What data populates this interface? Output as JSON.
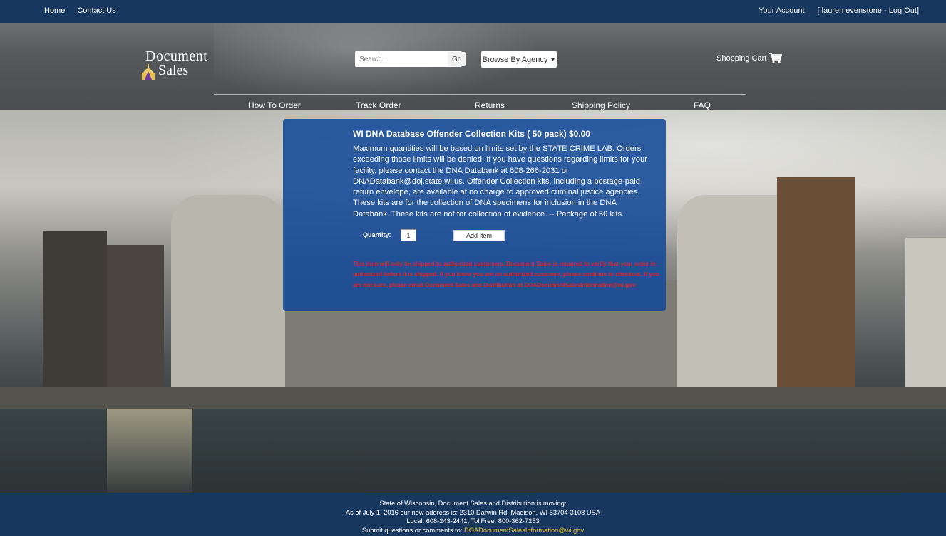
{
  "topbar": {
    "left_links": [
      "Home",
      "Contact Us"
    ],
    "account_label": "Your Account",
    "user_label": "[ lauren evenstone - Log Out]"
  },
  "header": {
    "logo": {
      "line1": "Document",
      "line2": "Sales"
    },
    "search": {
      "placeholder": "Search...",
      "button": "Go"
    },
    "browse_label": "Browse By Agency",
    "cart_label": "Shopping Cart",
    "icons": [
      "shopping-cart-icon",
      "caret-down-icon",
      "capitol-logo-icon"
    ]
  },
  "nav": {
    "items": [
      "How To Order",
      "Track Order",
      "Returns",
      "Shipping Policy",
      "FAQ"
    ]
  },
  "product": {
    "title": "WI DNA Database Offender Collection Kits ( 50 pack)  $0.00",
    "description": "Maximum quantities will be based on limits set by the STATE CRIME LAB. Orders exceeding those limits will be denied. If you have questions regarding limits for your facility, please contact the DNA Databank at 608-266-2031 or DNADatabank@doj.state.wi.us. Offender Collection kits, including a postage-paid return envelope, are available at no charge to approved criminal justice agencies. These kits are for the collection of DNA specimens for inclusion in the DNA Databank. These kits are not for collection of evidence. -- Package of 50 kits.",
    "quantity_label": "Quantity:",
    "quantity_value": "1",
    "add_button": "Add Item",
    "warning": "This item will only be shipped to authorized customers. Document Sales is required to verify that your order is authorized before it is shipped. If you know you are an authorized customer, please continue to checkout. If you are not sure, please email Document Sales and Distribution at",
    "warning_email": "DOADocumentSalesInformation@wi.gov"
  },
  "footer": {
    "line1": "State of Wisconsin, Document Sales and Distribution is moving:",
    "line2": "As of July 1, 2016 our new address is: 2310 Darwin Rd, Madison, WI 53704-3108 USA",
    "line3": "Local: 608-243-2441; TollFree: 800-362-7253",
    "line4_prefix": "Submit questions or comments to: ",
    "email": "DOADocumentSalesInformation@wi.gov"
  },
  "colors": {
    "bar": "#17375e",
    "panel": "#134997",
    "warning": "#e0222a",
    "footer_link": "#e8c51b"
  }
}
